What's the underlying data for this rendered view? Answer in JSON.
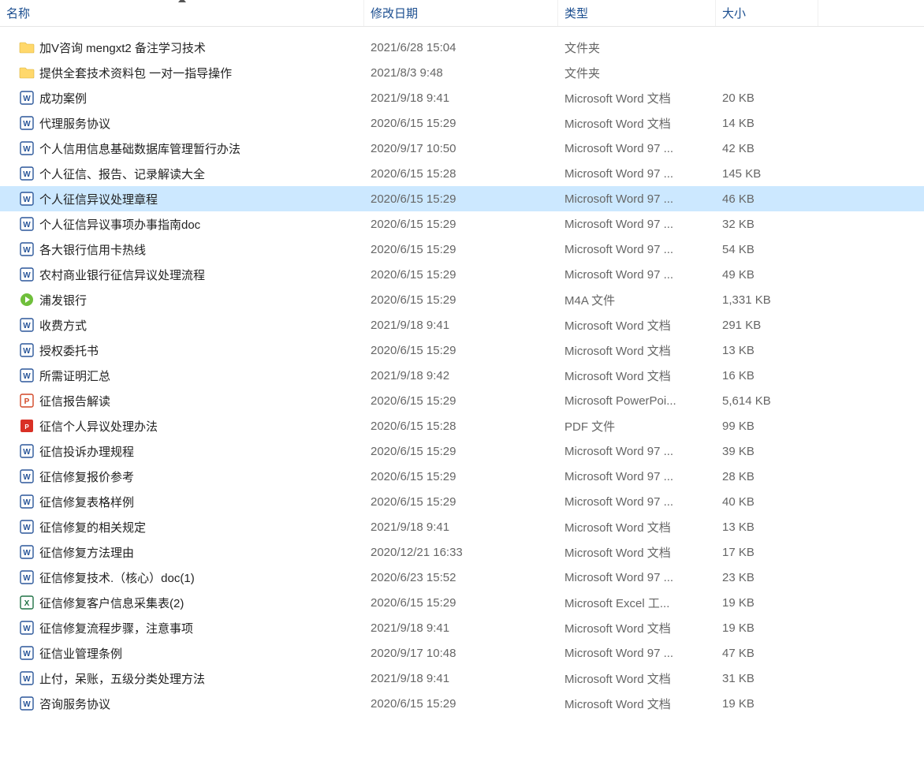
{
  "columns": {
    "name": "名称",
    "date": "修改日期",
    "type": "类型",
    "size": "大小"
  },
  "sorted_column": "name",
  "selected_index": 6,
  "files": [
    {
      "icon": "folder",
      "name": "加V咨询    mengxt2    备注学习技术",
      "date": "2021/6/28 15:04",
      "type": "文件夹",
      "size": ""
    },
    {
      "icon": "folder",
      "name": "提供全套技术资料包 一对一指导操作",
      "date": "2021/8/3 9:48",
      "type": "文件夹",
      "size": ""
    },
    {
      "icon": "word",
      "name": "成功案例",
      "date": "2021/9/18 9:41",
      "type": "Microsoft Word 文档",
      "size": "20 KB"
    },
    {
      "icon": "word",
      "name": "代理服务协议",
      "date": "2020/6/15 15:29",
      "type": "Microsoft Word 文档",
      "size": "14 KB"
    },
    {
      "icon": "word",
      "name": "个人信用信息基础数据库管理暂行办法",
      "date": "2020/9/17 10:50",
      "type": "Microsoft Word 97 ...",
      "size": "42 KB"
    },
    {
      "icon": "word",
      "name": "个人征信、报告、记录解读大全",
      "date": "2020/6/15 15:28",
      "type": "Microsoft Word 97 ...",
      "size": "145 KB"
    },
    {
      "icon": "word",
      "name": "个人征信异议处理章程",
      "date": "2020/6/15 15:29",
      "type": "Microsoft Word 97 ...",
      "size": "46 KB"
    },
    {
      "icon": "word",
      "name": "个人征信异议事项办事指南doc",
      "date": "2020/6/15 15:29",
      "type": "Microsoft Word 97 ...",
      "size": "32 KB"
    },
    {
      "icon": "word",
      "name": "各大银行信用卡热线",
      "date": "2020/6/15 15:29",
      "type": "Microsoft Word 97 ...",
      "size": "54 KB"
    },
    {
      "icon": "word",
      "name": "农村商业银行征信异议处理流程",
      "date": "2020/6/15 15:29",
      "type": "Microsoft Word 97 ...",
      "size": "49 KB"
    },
    {
      "icon": "audio",
      "name": "浦发银行",
      "date": "2020/6/15 15:29",
      "type": "M4A 文件",
      "size": "1,331 KB"
    },
    {
      "icon": "word",
      "name": "收费方式",
      "date": "2021/9/18 9:41",
      "type": "Microsoft Word 文档",
      "size": "291 KB"
    },
    {
      "icon": "word",
      "name": "授权委托书",
      "date": "2020/6/15 15:29",
      "type": "Microsoft Word 文档",
      "size": "13 KB"
    },
    {
      "icon": "word",
      "name": "所需证明汇总",
      "date": "2021/9/18 9:42",
      "type": "Microsoft Word 文档",
      "size": "16 KB"
    },
    {
      "icon": "ppt",
      "name": "征信报告解读",
      "date": "2020/6/15 15:29",
      "type": "Microsoft PowerPoi...",
      "size": "5,614 KB"
    },
    {
      "icon": "pdf",
      "name": "征信个人异议处理办法",
      "date": "2020/6/15 15:28",
      "type": "PDF 文件",
      "size": "99 KB"
    },
    {
      "icon": "word",
      "name": "征信投诉办理规程",
      "date": "2020/6/15 15:29",
      "type": "Microsoft Word 97 ...",
      "size": "39 KB"
    },
    {
      "icon": "word",
      "name": "征信修复报价参考",
      "date": "2020/6/15 15:29",
      "type": "Microsoft Word 97 ...",
      "size": "28 KB"
    },
    {
      "icon": "word",
      "name": "征信修复表格样例",
      "date": "2020/6/15 15:29",
      "type": "Microsoft Word 97 ...",
      "size": "40 KB"
    },
    {
      "icon": "word",
      "name": "征信修复的相关规定",
      "date": "2021/9/18 9:41",
      "type": "Microsoft Word 文档",
      "size": "13 KB"
    },
    {
      "icon": "word",
      "name": "征信修复方法理由",
      "date": "2020/12/21 16:33",
      "type": "Microsoft Word 文档",
      "size": "17 KB"
    },
    {
      "icon": "word",
      "name": "征信修复技术.（核心）doc(1)",
      "date": "2020/6/23 15:52",
      "type": "Microsoft Word 97 ...",
      "size": "23 KB"
    },
    {
      "icon": "excel",
      "name": "征信修复客户信息采集表(2)",
      "date": "2020/6/15 15:29",
      "type": "Microsoft Excel 工...",
      "size": "19 KB"
    },
    {
      "icon": "word",
      "name": "征信修复流程步骤，注意事项",
      "date": "2021/9/18 9:41",
      "type": "Microsoft Word 文档",
      "size": "19 KB"
    },
    {
      "icon": "word",
      "name": "征信业管理条例",
      "date": "2020/9/17 10:48",
      "type": "Microsoft Word 97 ...",
      "size": "47 KB"
    },
    {
      "icon": "word",
      "name": "止付，呆账，五级分类处理方法",
      "date": "2021/9/18 9:41",
      "type": "Microsoft Word 文档",
      "size": "31 KB"
    },
    {
      "icon": "word",
      "name": "咨询服务协议",
      "date": "2020/6/15 15:29",
      "type": "Microsoft Word 文档",
      "size": "19 KB"
    }
  ]
}
